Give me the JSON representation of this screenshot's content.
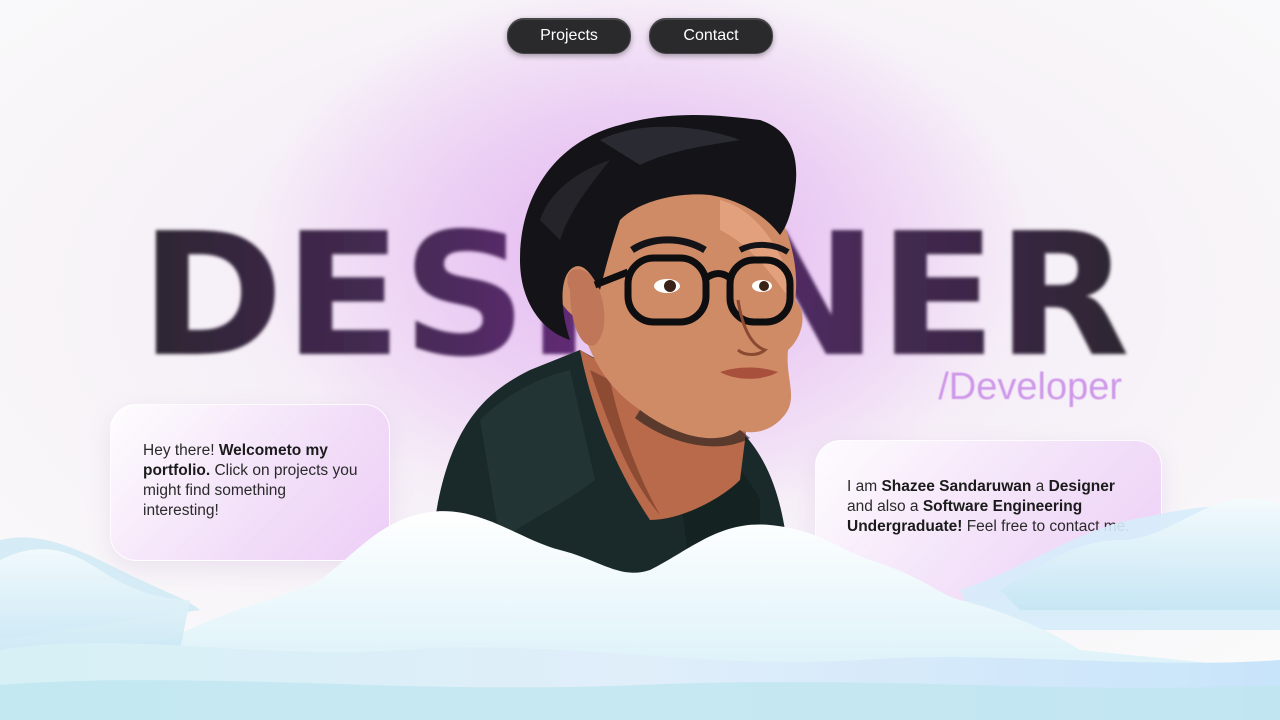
{
  "nav": {
    "projects_label": "Projects",
    "contact_label": "Contact"
  },
  "hero": {
    "title": "DESIGNER",
    "subtitle": "/Developer"
  },
  "intro_card": {
    "greeting": "Hey there! ",
    "welcome_bold": "Welcometo my portfolio.",
    "body": " Click on projects you might find something interesting!"
  },
  "about_card": {
    "prefix": "I am ",
    "name_bold": "Shazee Sandaruwan",
    "mid1": " a ",
    "role1_bold": "Designer",
    "mid2": " and also a ",
    "role2_bold": "Software Engineering Undergraduate!",
    "suffix": " Feel free to contact me."
  },
  "colors": {
    "nav_button_bg": "#2a2a2d",
    "title_dark": "#2c2631",
    "title_purple": "#5a2a6e",
    "subtitle": "#c889e8",
    "glow_pink": "#e2b4f0",
    "cloud_light": "#eaf6fb",
    "cloud_blue": "#bfe3f5"
  }
}
